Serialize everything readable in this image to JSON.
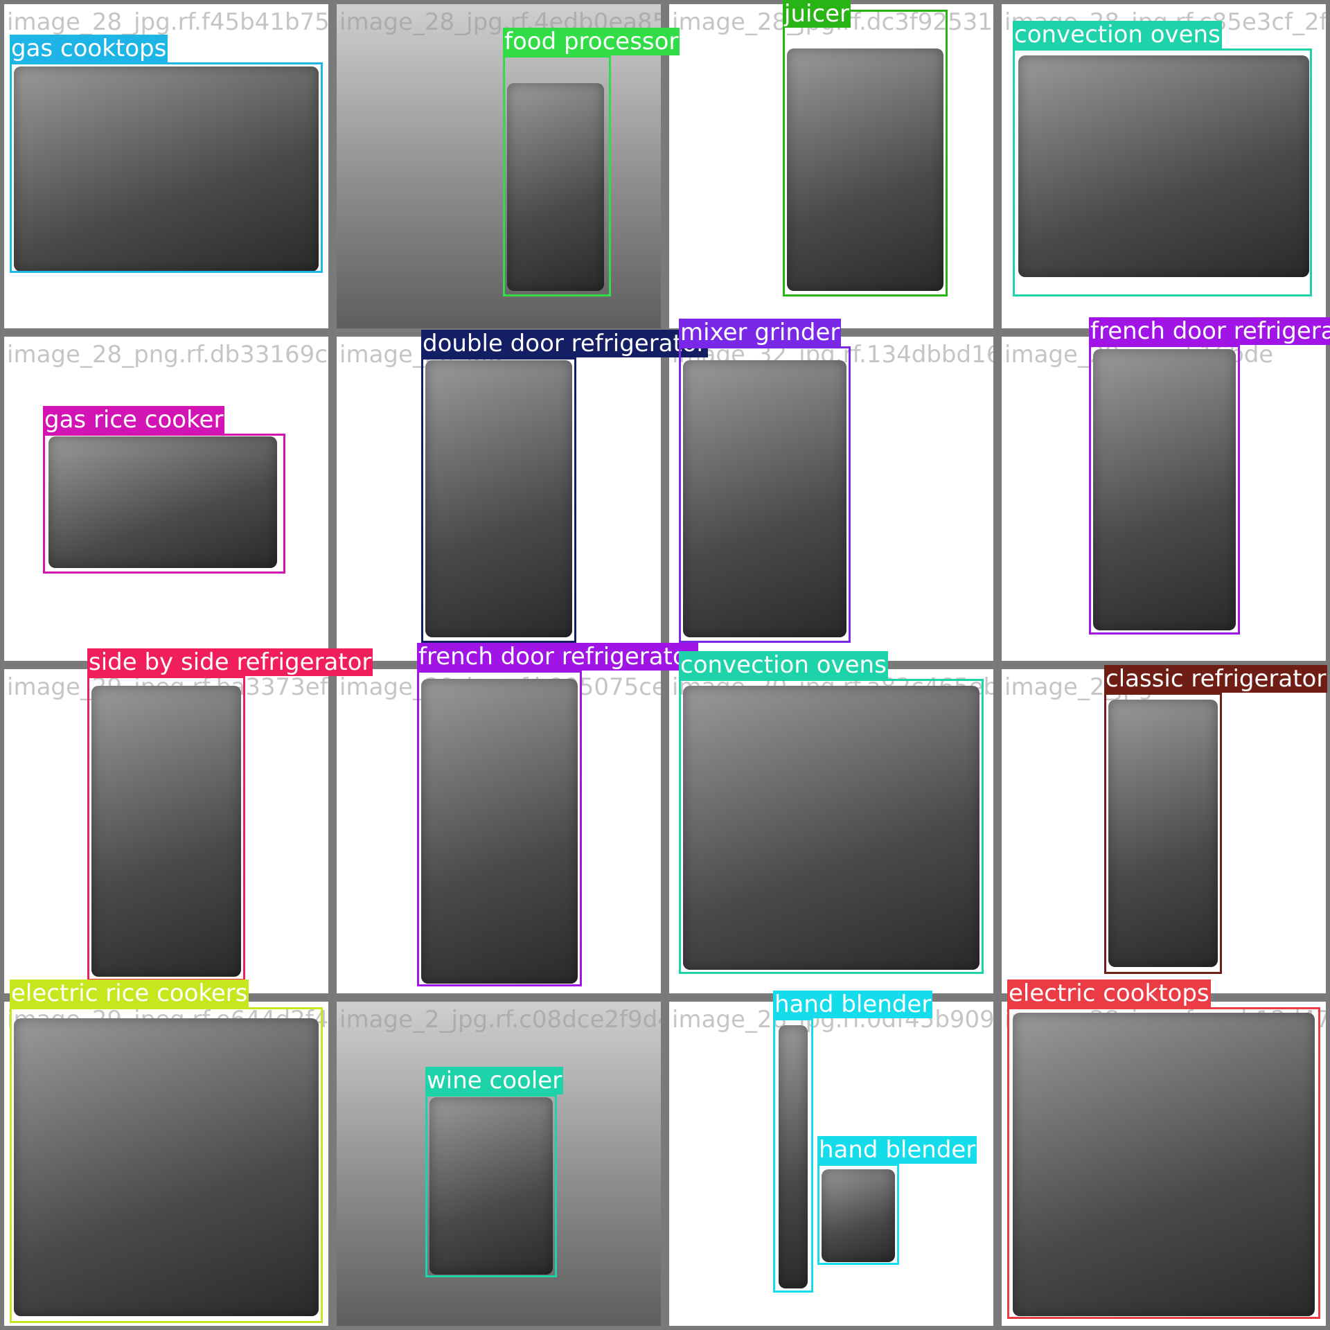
{
  "tiles": [
    {
      "filename": "image_28_jpg.rf.f45b41b752f55f7e1b256d914",
      "bg": "white"
    },
    {
      "filename": "image_28_jpg.rf.4edb0ea85d5f0d2",
      "bg": "photo"
    },
    {
      "filename": "image_28_jpg.rf.dc3f92531f43aae49502",
      "bg": "white"
    },
    {
      "filename": "image_28_jpg.rf.c85e3cf_2f0f23bae",
      "bg": "white"
    },
    {
      "filename": "image_28_png.rf.db33169cf8587cf9",
      "bg": "white"
    },
    {
      "filename": "image_28_jpg",
      "bg": "white"
    },
    {
      "filename": "image_32_jpg.rf.134dbbd161afc2eb0e0995",
      "bg": "white"
    },
    {
      "filename": "image_28_jpg.rf.16bde",
      "bg": "white"
    },
    {
      "filename": "image_29_jpeg.rf.ba3373ef9",
      "bg": "white"
    },
    {
      "filename": "image_29_jpg.rf.b995075ce",
      "bg": "white"
    },
    {
      "filename": "image_20_jpg.rf.a82c465eb6",
      "bg": "white"
    },
    {
      "filename": "image_2_jpg",
      "bg": "white"
    },
    {
      "filename": "image_29_jpeg.rf.e644d2f48ff",
      "bg": "white"
    },
    {
      "filename": "image_2_jpg.rf.c08dce2f9d4cf",
      "bg": "photo"
    },
    {
      "filename": "image_28_jpg.rf.0df45b909e9",
      "bg": "white"
    },
    {
      "filename": "image_28_jpg.rf.caab12d471",
      "bg": "white"
    }
  ],
  "detections": [
    {
      "tile": 0,
      "label": "gas cooktops",
      "color": "#1eb4e6"
    },
    {
      "tile": 1,
      "label": "food processor",
      "color": "#32dc46"
    },
    {
      "tile": 2,
      "label": "juicer",
      "color": "#28b414"
    },
    {
      "tile": 3,
      "label": "convection ovens",
      "color": "#1ed2aa"
    },
    {
      "tile": 4,
      "label": "gas rice cooker",
      "color": "#d214b4"
    },
    {
      "tile": 5,
      "label": "double door refrigerator",
      "color": "#141e64"
    },
    {
      "tile": 6,
      "label": "mixer grinder",
      "color": "#7828e6"
    },
    {
      "tile": 7,
      "label": "french door refrigerator",
      "color": "#a014e6"
    },
    {
      "tile": 8,
      "label": "side by side refrigerator",
      "color": "#f01e5a"
    },
    {
      "tile": 9,
      "label": "french door refrigerator",
      "color": "#a014e6"
    },
    {
      "tile": 10,
      "label": "convection ovens",
      "color": "#1ed2aa"
    },
    {
      "tile": 11,
      "label": "classic refrigerator",
      "color": "#6e1e14"
    },
    {
      "tile": 12,
      "label": "electric rice cookers",
      "color": "#c8e61e"
    },
    {
      "tile": 13,
      "label": "wine cooler",
      "color": "#1ed2aa"
    },
    {
      "tile": 14,
      "label": "hand blender",
      "color": "#14dceb"
    },
    {
      "tile": 14,
      "label": "hand blender",
      "color": "#14dceb"
    },
    {
      "tile": 15,
      "label": "electric cooktops",
      "color": "#eb3c46"
    }
  ]
}
